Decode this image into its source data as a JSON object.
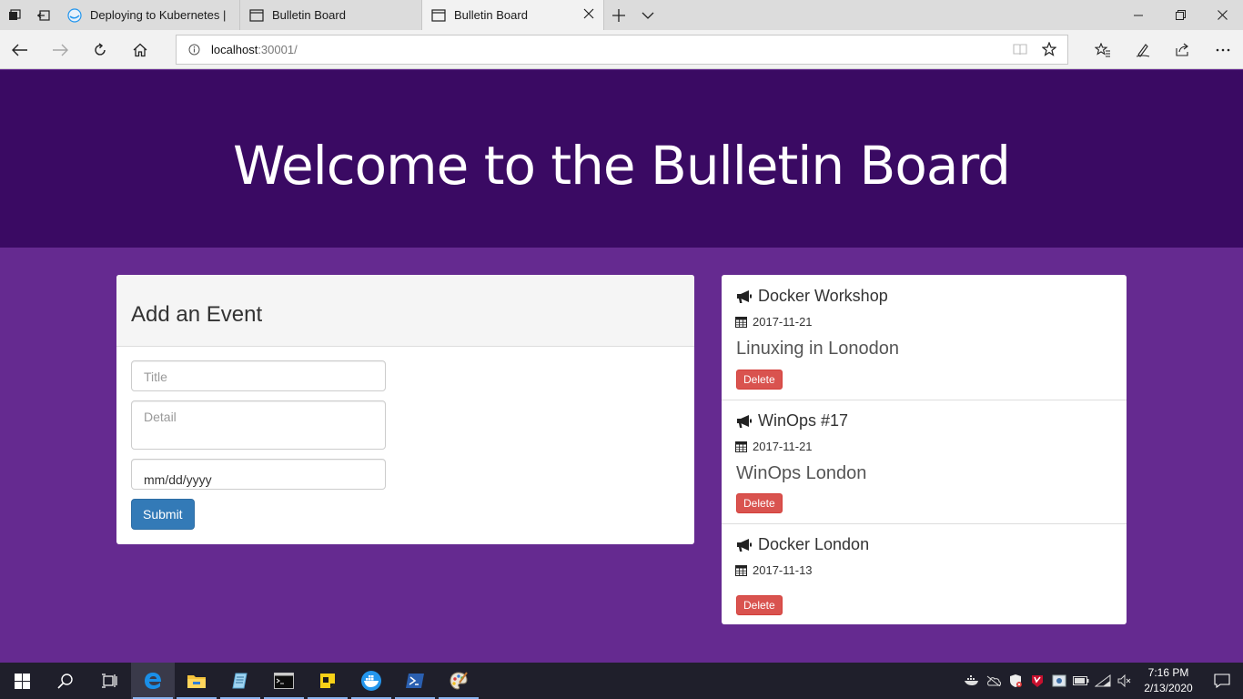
{
  "browser": {
    "tabs": [
      {
        "label": "Deploying to Kubernetes | D",
        "active": false,
        "favicon": "docker-docs-icon"
      },
      {
        "label": "Bulletin Board",
        "active": false,
        "favicon": "page-icon"
      },
      {
        "label": "Bulletin Board",
        "active": true,
        "favicon": "page-icon"
      }
    ],
    "address": {
      "host": "localhost",
      "port_path": ":30001/"
    }
  },
  "page": {
    "header_title": "Welcome to the Bulletin Board",
    "form": {
      "heading": "Add an Event",
      "title_placeholder": "Title",
      "detail_placeholder": "Detail",
      "date_placeholder": "mm/dd/yyyy",
      "submit_label": "Submit"
    },
    "events": [
      {
        "title": "Docker Workshop",
        "date": "2017-11-21",
        "detail": "Linuxing in Lonodon",
        "delete_label": "Delete"
      },
      {
        "title": "WinOps #17",
        "date": "2017-11-21",
        "detail": "WinOps London",
        "delete_label": "Delete"
      },
      {
        "title": "Docker London",
        "date": "2017-11-13",
        "detail": "",
        "delete_label": "Delete"
      }
    ]
  },
  "taskbar": {
    "time": "7:16 PM",
    "date": "2/13/2020",
    "apps": [
      "start-icon",
      "search-icon",
      "task-view-icon",
      "edge-icon",
      "file-explorer-icon",
      "notepad-icon",
      "cmd-icon",
      "sticky-notes-icon",
      "docker-icon",
      "powershell-icon",
      "paint-icon"
    ]
  },
  "colors": {
    "page_bg": "#652a90",
    "header_bg": "#3a0a63",
    "primary_button": "#337ab7",
    "danger_button": "#d9534f"
  }
}
